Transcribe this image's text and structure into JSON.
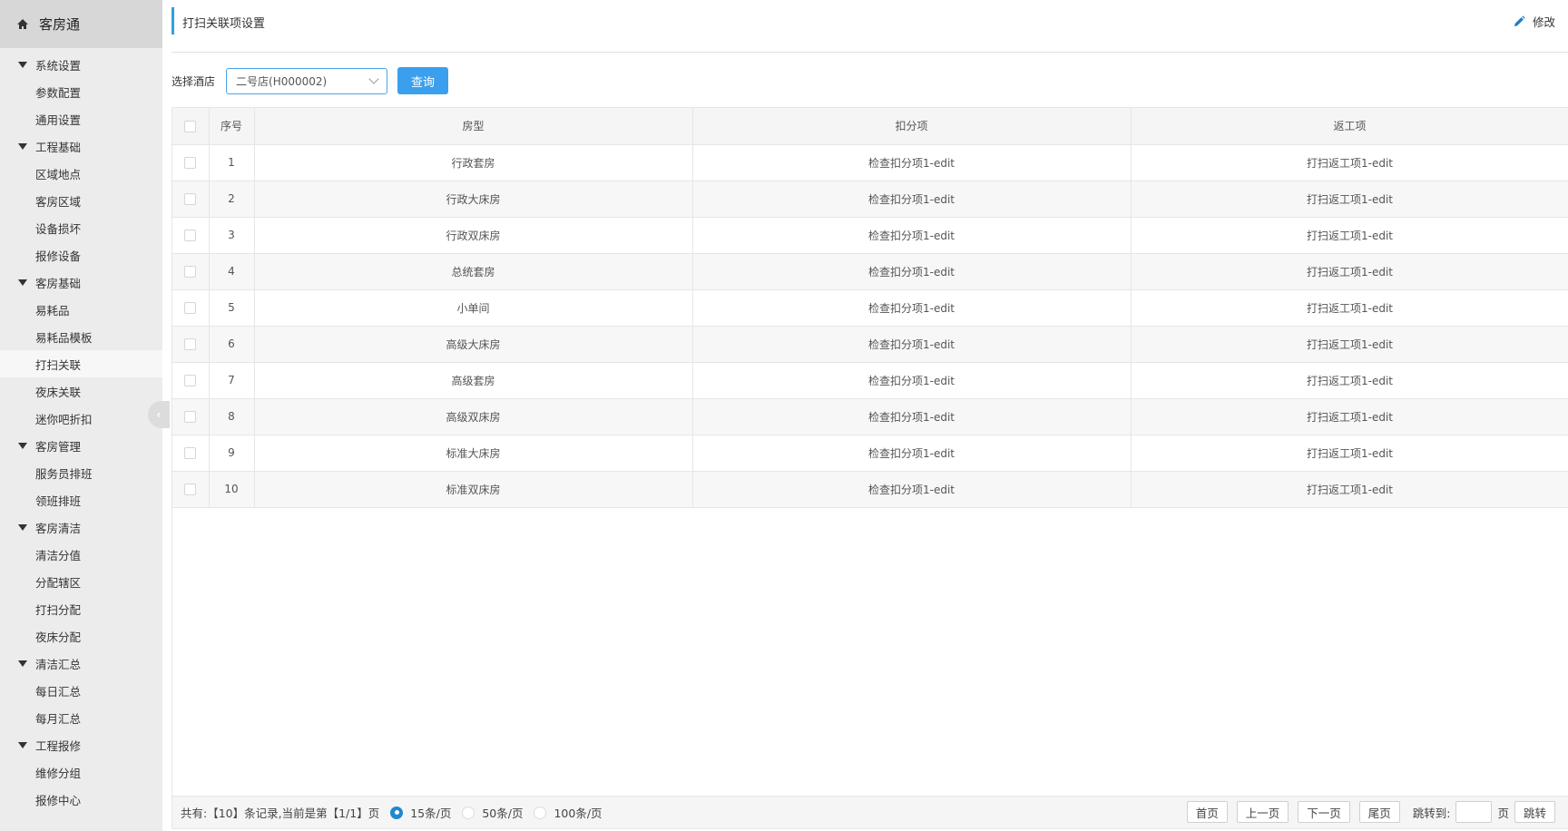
{
  "sidebar": {
    "app_title": "客房通",
    "groups": [
      {
        "label": "系统设置",
        "items": [
          "参数配置",
          "通用设置"
        ]
      },
      {
        "label": "工程基础",
        "items": [
          "区域地点",
          "客房区域",
          "设备损坏",
          "报修设备"
        ]
      },
      {
        "label": "客房基础",
        "items": [
          "易耗品",
          "易耗品模板",
          "打扫关联",
          "夜床关联",
          "迷你吧折扣"
        ]
      },
      {
        "label": "客房管理",
        "items": [
          "服务员排班",
          "领班排班"
        ]
      },
      {
        "label": "客房清洁",
        "items": [
          "清洁分值",
          "分配辖区",
          "打扫分配",
          "夜床分配"
        ]
      },
      {
        "label": "清洁汇总",
        "items": [
          "每日汇总",
          "每月汇总"
        ]
      },
      {
        "label": "工程报修",
        "items": [
          "维修分组",
          "报修中心"
        ]
      }
    ],
    "active_item": "打扫关联"
  },
  "header": {
    "title": "打扫关联项设置",
    "edit_label": "修改"
  },
  "filter": {
    "label": "选择酒店",
    "selected_hotel": "二号店(H000002)",
    "query_label": "查询"
  },
  "table": {
    "columns": [
      "序号",
      "房型",
      "扣分项",
      "返工项"
    ],
    "rows": [
      {
        "no": "1",
        "room_type": "行政套房",
        "deduction": "检查扣分项1-edit",
        "rework": "打扫返工项1-edit"
      },
      {
        "no": "2",
        "room_type": "行政大床房",
        "deduction": "检查扣分项1-edit",
        "rework": "打扫返工项1-edit"
      },
      {
        "no": "3",
        "room_type": "行政双床房",
        "deduction": "检查扣分项1-edit",
        "rework": "打扫返工项1-edit"
      },
      {
        "no": "4",
        "room_type": "总统套房",
        "deduction": "检查扣分项1-edit",
        "rework": "打扫返工项1-edit"
      },
      {
        "no": "5",
        "room_type": "小单间",
        "deduction": "检查扣分项1-edit",
        "rework": "打扫返工项1-edit"
      },
      {
        "no": "6",
        "room_type": "高级大床房",
        "deduction": "检查扣分项1-edit",
        "rework": "打扫返工项1-edit"
      },
      {
        "no": "7",
        "room_type": "高级套房",
        "deduction": "检查扣分项1-edit",
        "rework": "打扫返工项1-edit"
      },
      {
        "no": "8",
        "room_type": "高级双床房",
        "deduction": "检查扣分项1-edit",
        "rework": "打扫返工项1-edit"
      },
      {
        "no": "9",
        "room_type": "标准大床房",
        "deduction": "检查扣分项1-edit",
        "rework": "打扫返工项1-edit"
      },
      {
        "no": "10",
        "room_type": "标准双床房",
        "deduction": "检查扣分项1-edit",
        "rework": "打扫返工项1-edit"
      }
    ]
  },
  "pager": {
    "summary": "共有:【10】条记录,当前是第【1/1】页",
    "page_sizes": [
      "15条/页",
      "50条/页",
      "100条/页"
    ],
    "selected_page_size": "15条/页",
    "first": "首页",
    "prev": "上一页",
    "next": "下一页",
    "last": "尾页",
    "jump_label": "跳转到:",
    "page_unit": "页",
    "jump_button": "跳转"
  },
  "colors": {
    "accent": "#2ea0e4",
    "query_button": "#3aa0ee",
    "radio_selected": "#1e88d0"
  }
}
